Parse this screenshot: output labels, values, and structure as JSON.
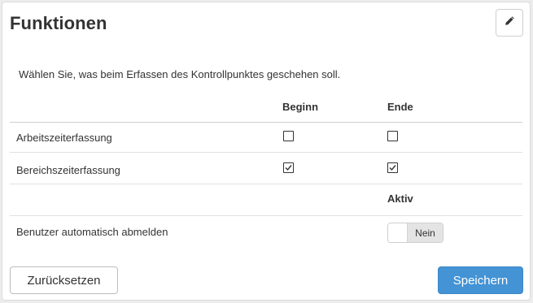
{
  "panel": {
    "title": "Funktionen",
    "description": "Wählen Sie, was beim Erfassen des Kontrollpunktes geschehen soll."
  },
  "columns": {
    "begin": "Beginn",
    "end": "Ende",
    "active": "Aktiv"
  },
  "rows": [
    {
      "label": "Arbeitszeiterfassung",
      "begin_checked": false,
      "end_checked": false
    },
    {
      "label": "Bereichszeiterfassung",
      "begin_checked": true,
      "end_checked": true
    }
  ],
  "auto_logout": {
    "label": "Benutzer automatisch abmelden",
    "state_label": "Nein",
    "enabled": false
  },
  "buttons": {
    "reset": "Zurücksetzen",
    "save": "Speichern"
  },
  "icons": {
    "edit": "pencil-icon"
  },
  "colors": {
    "primary": "#4393d5",
    "text": "#333333",
    "toggle_off": "#e4e4e4"
  }
}
